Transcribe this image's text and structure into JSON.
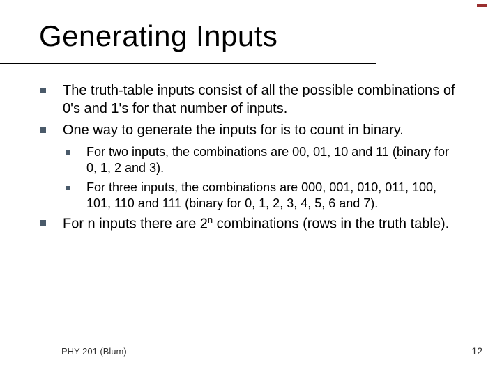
{
  "title": "Generating Inputs",
  "bullets": [
    {
      "text": "The truth-table inputs consist of all the possible combinations of 0's and 1's for that number of inputs."
    },
    {
      "text": "One way to generate the inputs for is to count in binary.",
      "sub": [
        "For two inputs, the combinations are 00, 01, 10 and 11 (binary for 0, 1, 2 and 3).",
        "For three inputs, the combinations are 000, 001, 010, 011, 100, 101, 110 and 111 (binary for 0, 1, 2, 3, 4, 5, 6 and 7)."
      ]
    },
    {
      "text_pre": "For n inputs there are 2",
      "sup": "n",
      "text_post": " combinations (rows in the truth table)."
    }
  ],
  "footer": {
    "left": "PHY 201 (Blum)",
    "page": "12"
  }
}
